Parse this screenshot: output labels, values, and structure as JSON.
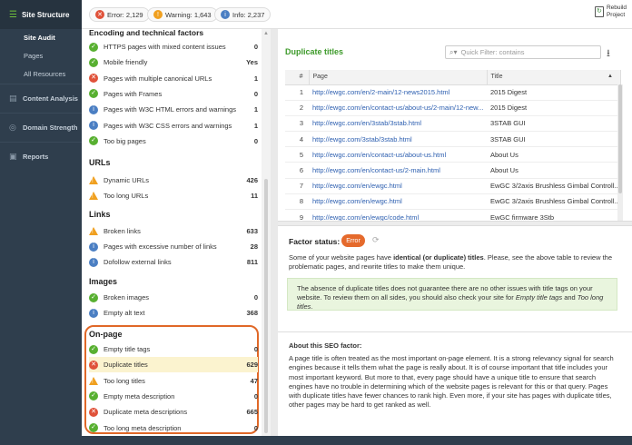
{
  "sidebar": {
    "header": "Site Structure",
    "subitems": [
      "Site Audit",
      "Pages",
      "All Resources"
    ],
    "sections": [
      "Content Analysis",
      "Domain Strength",
      "Reports"
    ]
  },
  "topbar": {
    "error_label": "Error: 2,129",
    "warning_label": "Warning: 1,643",
    "info_label": "Info: 2,237",
    "rebuild_line1": "Rebuild",
    "rebuild_line2": "Project"
  },
  "factors": {
    "top_heading": "Encoding and technical factors",
    "technical": [
      {
        "status": "ok",
        "label": "HTTPS pages with mixed content issues",
        "value": "0"
      },
      {
        "status": "ok",
        "label": "Mobile friendly",
        "value": "Yes"
      },
      {
        "status": "err",
        "label": "Pages with multiple canonical URLs",
        "value": "1"
      },
      {
        "status": "ok",
        "label": "Pages with Frames",
        "value": "0"
      },
      {
        "status": "info",
        "label": "Pages with W3C HTML errors and warnings",
        "value": "1"
      },
      {
        "status": "info",
        "label": "Pages with W3C CSS errors and warnings",
        "value": "1"
      },
      {
        "status": "ok",
        "label": "Too big pages",
        "value": "0"
      }
    ],
    "urls_heading": "URLs",
    "urls": [
      {
        "status": "warn",
        "label": "Dynamic URLs",
        "value": "426"
      },
      {
        "status": "warn",
        "label": "Too long URLs",
        "value": "11"
      }
    ],
    "links_heading": "Links",
    "links": [
      {
        "status": "warn",
        "label": "Broken links",
        "value": "633"
      },
      {
        "status": "info",
        "label": "Pages with excessive number of links",
        "value": "28"
      },
      {
        "status": "info",
        "label": "Dofollow external links",
        "value": "811"
      }
    ],
    "images_heading": "Images",
    "images": [
      {
        "status": "ok",
        "label": "Broken images",
        "value": "0"
      },
      {
        "status": "info",
        "label": "Empty alt text",
        "value": "368"
      }
    ],
    "onpage_heading": "On-page",
    "onpage": [
      {
        "status": "ok",
        "label": "Empty title tags",
        "value": "0"
      },
      {
        "status": "err",
        "label": "Duplicate titles",
        "value": "629"
      },
      {
        "status": "warn",
        "label": "Too long titles",
        "value": "47"
      },
      {
        "status": "ok",
        "label": "Empty meta description",
        "value": "0"
      },
      {
        "status": "err",
        "label": "Duplicate meta descriptions",
        "value": "665"
      },
      {
        "status": "ok",
        "label": "Too long meta description",
        "value": "0"
      }
    ]
  },
  "main": {
    "title": "Duplicate titles",
    "filter_placeholder": "Quick Filter: contains",
    "columns": [
      "#",
      "Page",
      "Title"
    ],
    "rows": [
      [
        "1",
        "http://ewgc.com/en/2-main/12-news2015.html",
        "2015 Digest"
      ],
      [
        "2",
        "http://ewgc.com/en/contact-us/about-us/2-main/12-new...",
        "2015 Digest"
      ],
      [
        "3",
        "http://ewgc.com/en/3stab/3stab.html",
        "3STAB GUI"
      ],
      [
        "4",
        "http://ewgc.com/3stab/3stab.html",
        "3STAB GUI"
      ],
      [
        "5",
        "http://ewgc.com/en/contact-us/about-us.html",
        "About Us"
      ],
      [
        "6",
        "http://ewgc.com/en/contact-us/2-main.html",
        "About Us"
      ],
      [
        "7",
        "http://ewgc.com/en/ewgc.html",
        "EwGC 3/2axis Brushless Gimbal Controll..."
      ],
      [
        "8",
        "http://ewgc.com/en/ewgc.html",
        "EwGC 3/2axis Brushless Gimbal Controll..."
      ],
      [
        "9",
        "http://ewgc.com/en/ewgc/code.html",
        "EwGC firmware 3Stb"
      ]
    ],
    "factor_status_label": "Factor status:",
    "factor_status_value": "Error",
    "status_text_a": "Some of your website pages have ",
    "status_text_bold": "identical (or duplicate) titles",
    "status_text_b": ". Please, see the above table to review the problematic pages, and rewrite titles to make them unique.",
    "notice_a": "The absence of duplicate titles does not guarantee there are no other issues with title tags on your website. To review them on all sides, you should also check your site for ",
    "notice_em1": "Empty title tags",
    "notice_and": " and ",
    "notice_em2": "Too long titles",
    "notice_end": ".",
    "about_title": "About this SEO factor:",
    "about_text": "A page title is often treated as the most important on-page element. It is a strong relevancy signal for search engines because it tells them what the page is really about. It is of course important that title includes your most important keyword. But more to that, every page should have a unique title to ensure that search engines have no trouble in determining which of the website pages is relevant for this or that query. Pages with duplicate titles have fewer chances to rank high. Even more, if your site has pages with duplicate titles, other pages may be hard to get ranked as well."
  },
  "colors": {
    "sidebar_bg": "#2f3e4d",
    "accent_green": "#3d9a2a",
    "error": "#e0523a",
    "warning": "#f0a020",
    "info": "#4b7fc3",
    "ok": "#58b031",
    "highlight_ring": "#e06828"
  }
}
